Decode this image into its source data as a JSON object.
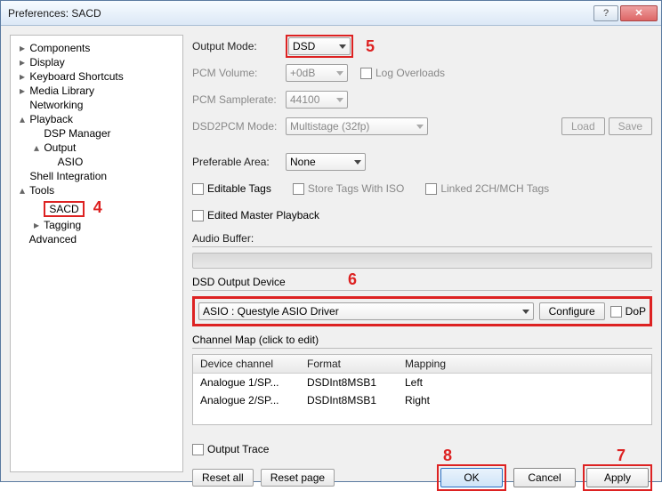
{
  "window": {
    "title": "Preferences: SACD"
  },
  "tree": {
    "items": [
      {
        "sym": "▸",
        "label": "Components",
        "ind": 0
      },
      {
        "sym": "▸",
        "label": "Display",
        "ind": 0
      },
      {
        "sym": "▸",
        "label": "Keyboard Shortcuts",
        "ind": 0
      },
      {
        "sym": "▸",
        "label": "Media Library",
        "ind": 0
      },
      {
        "sym": "",
        "label": "Networking",
        "ind": 0
      },
      {
        "sym": "▴",
        "label": "Playback",
        "ind": 0
      },
      {
        "sym": "",
        "label": "DSP Manager",
        "ind": 1
      },
      {
        "sym": "▴",
        "label": "Output",
        "ind": 1
      },
      {
        "sym": "",
        "label": "ASIO",
        "ind": 2
      },
      {
        "sym": "",
        "label": "Shell Integration",
        "ind": 0
      },
      {
        "sym": "▴",
        "label": "Tools",
        "ind": 0
      },
      {
        "sym": "",
        "label": "SACD",
        "ind": 1,
        "sel": true
      },
      {
        "sym": "▸",
        "label": "Tagging",
        "ind": 1
      },
      {
        "sym": "",
        "label": "Advanced",
        "ind": 0
      }
    ]
  },
  "form": {
    "output_mode": {
      "label": "Output Mode:",
      "value": "DSD"
    },
    "pcm_volume": {
      "label": "PCM Volume:",
      "value": "+0dB"
    },
    "log_overloads": "Log Overloads",
    "pcm_samplerate": {
      "label": "PCM Samplerate:",
      "value": "44100"
    },
    "dsd2pcm": {
      "label": "DSD2PCM Mode:",
      "value": "Multistage (32fp)"
    },
    "load": "Load",
    "save": "Save",
    "pref_area": {
      "label": "Preferable Area:",
      "value": "None"
    },
    "editable_tags": "Editable Tags",
    "store_tags": "Store Tags With ISO",
    "linked": "Linked 2CH/MCH Tags",
    "edited_master": "Edited Master Playback",
    "audio_buffer": "Audio Buffer:",
    "dsd_device": {
      "label": "DSD Output Device",
      "value": "ASIO : Questyle ASIO Driver"
    },
    "configure": "Configure",
    "dop": "DoP",
    "channel_map": "Channel Map (click to edit)",
    "output_trace": "Output Trace"
  },
  "table": {
    "headers": {
      "c1": "Device channel",
      "c2": "Format",
      "c3": "Mapping"
    },
    "rows": [
      {
        "c1": "Analogue 1/SP...",
        "c2": "DSDInt8MSB1",
        "c3": "Left"
      },
      {
        "c1": "Analogue 2/SP...",
        "c2": "DSDInt8MSB1",
        "c3": "Right"
      }
    ]
  },
  "buttons": {
    "reset_all": "Reset all",
    "reset_page": "Reset page",
    "ok": "OK",
    "cancel": "Cancel",
    "apply": "Apply"
  },
  "annotations": {
    "a4": "4",
    "a5": "5",
    "a6": "6",
    "a7": "7",
    "a8": "8"
  }
}
